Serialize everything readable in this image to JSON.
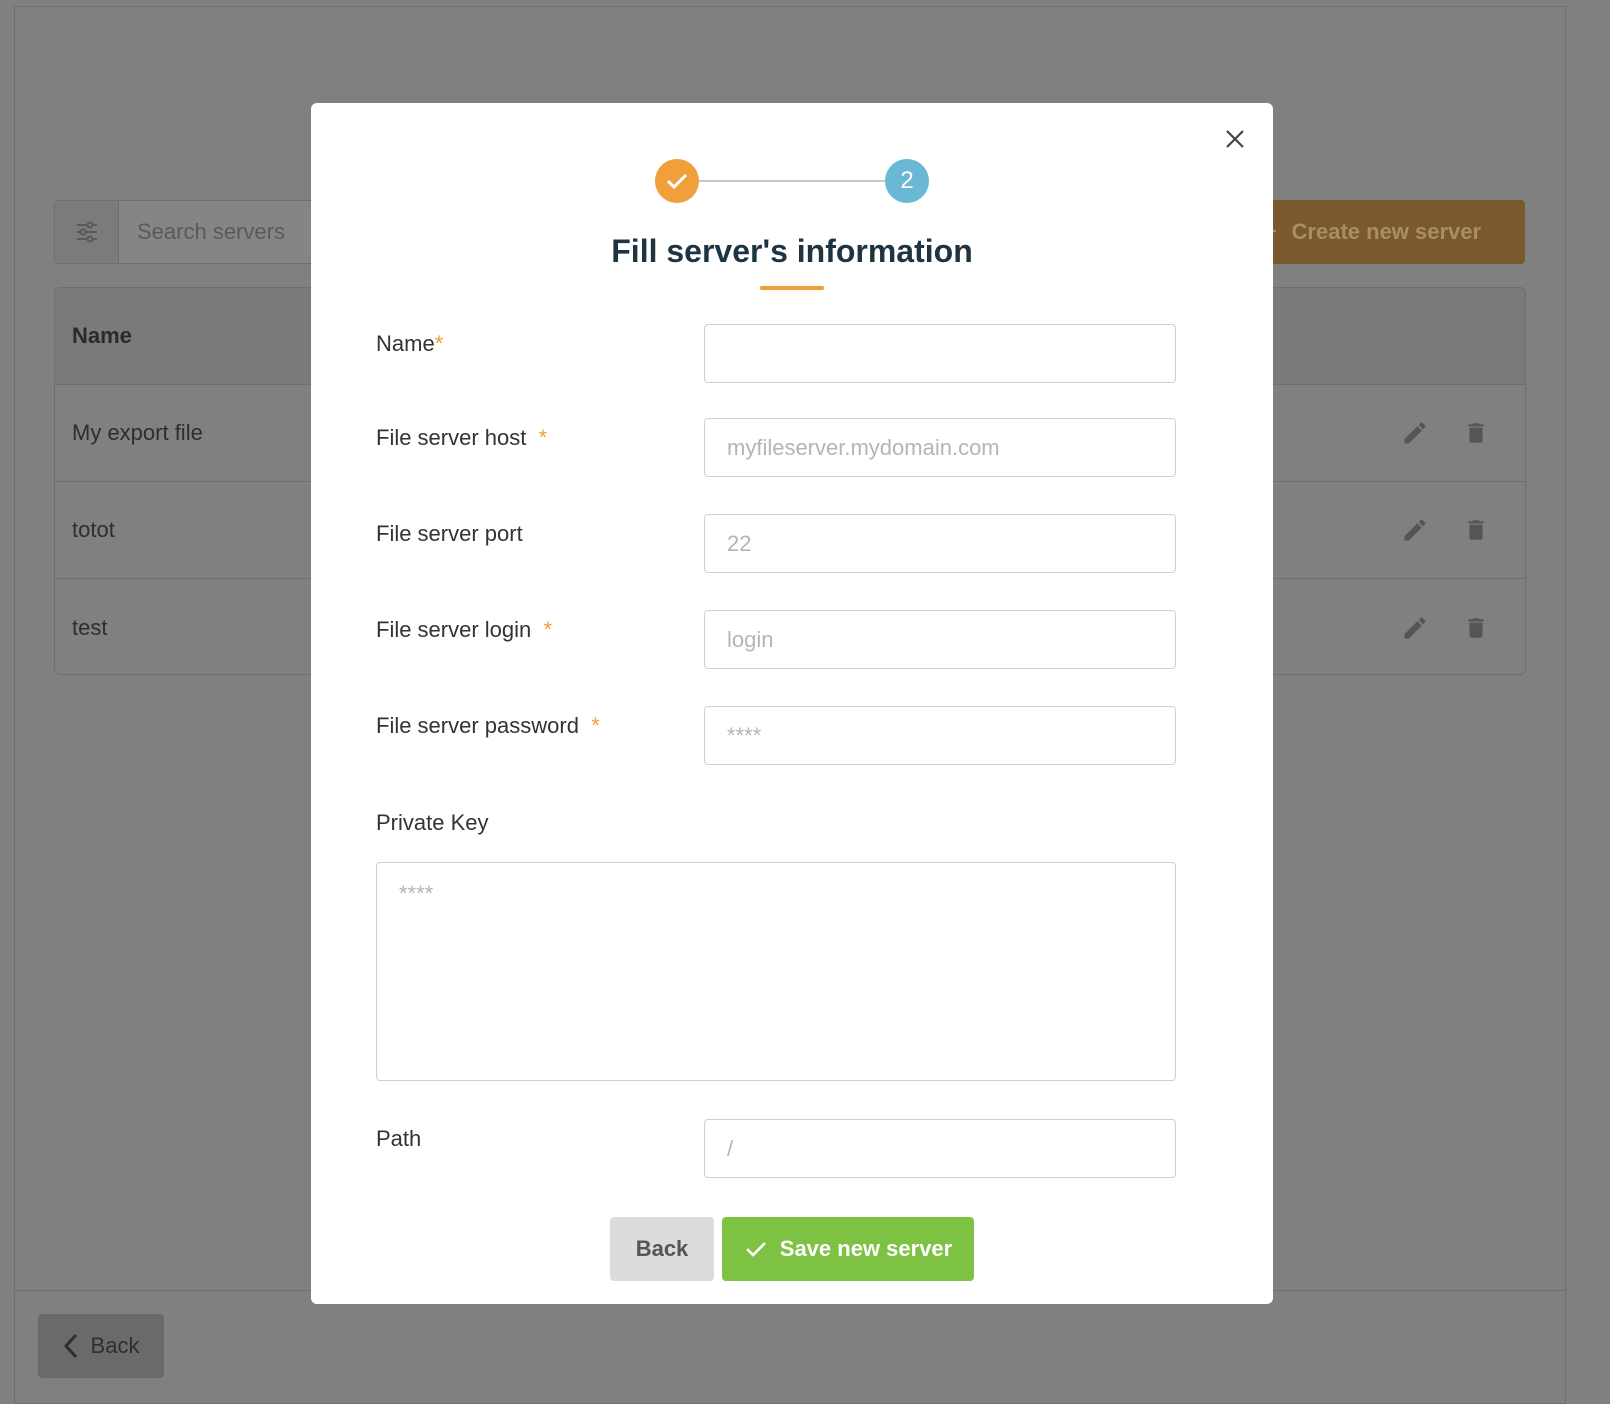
{
  "background": {
    "search": {
      "placeholder": "Search servers"
    },
    "create_button": {
      "label": "Create new server"
    },
    "table": {
      "header_name": "Name",
      "rows": [
        {
          "name": "My export file"
        },
        {
          "name": "totot"
        },
        {
          "name": "test"
        }
      ]
    },
    "back_button": {
      "label": "Back"
    }
  },
  "modal": {
    "stepper": {
      "step2_label": "2"
    },
    "title": "Fill server's information",
    "fields": {
      "name": {
        "label": "Name",
        "required_mark": "*",
        "value": "",
        "placeholder": ""
      },
      "host": {
        "label": "File server host",
        "required_mark": "*",
        "value": "",
        "placeholder": "myfileserver.mydomain.com"
      },
      "port": {
        "label": "File server port",
        "value": "",
        "placeholder": "22"
      },
      "login": {
        "label": "File server login",
        "required_mark": "*",
        "value": "",
        "placeholder": "login"
      },
      "password": {
        "label": "File server password",
        "required_mark": "*",
        "value": "",
        "placeholder": "****"
      },
      "private_key": {
        "label": "Private Key",
        "value": "",
        "placeholder": "****"
      },
      "path": {
        "label": "Path",
        "value": "",
        "placeholder": "/"
      }
    },
    "buttons": {
      "back": "Back",
      "save": "Save new server"
    }
  },
  "colors": {
    "accent_orange": "#f0a03a",
    "step_blue": "#6bb8d4",
    "save_green": "#7dc242",
    "title_dark": "#1e3440"
  }
}
